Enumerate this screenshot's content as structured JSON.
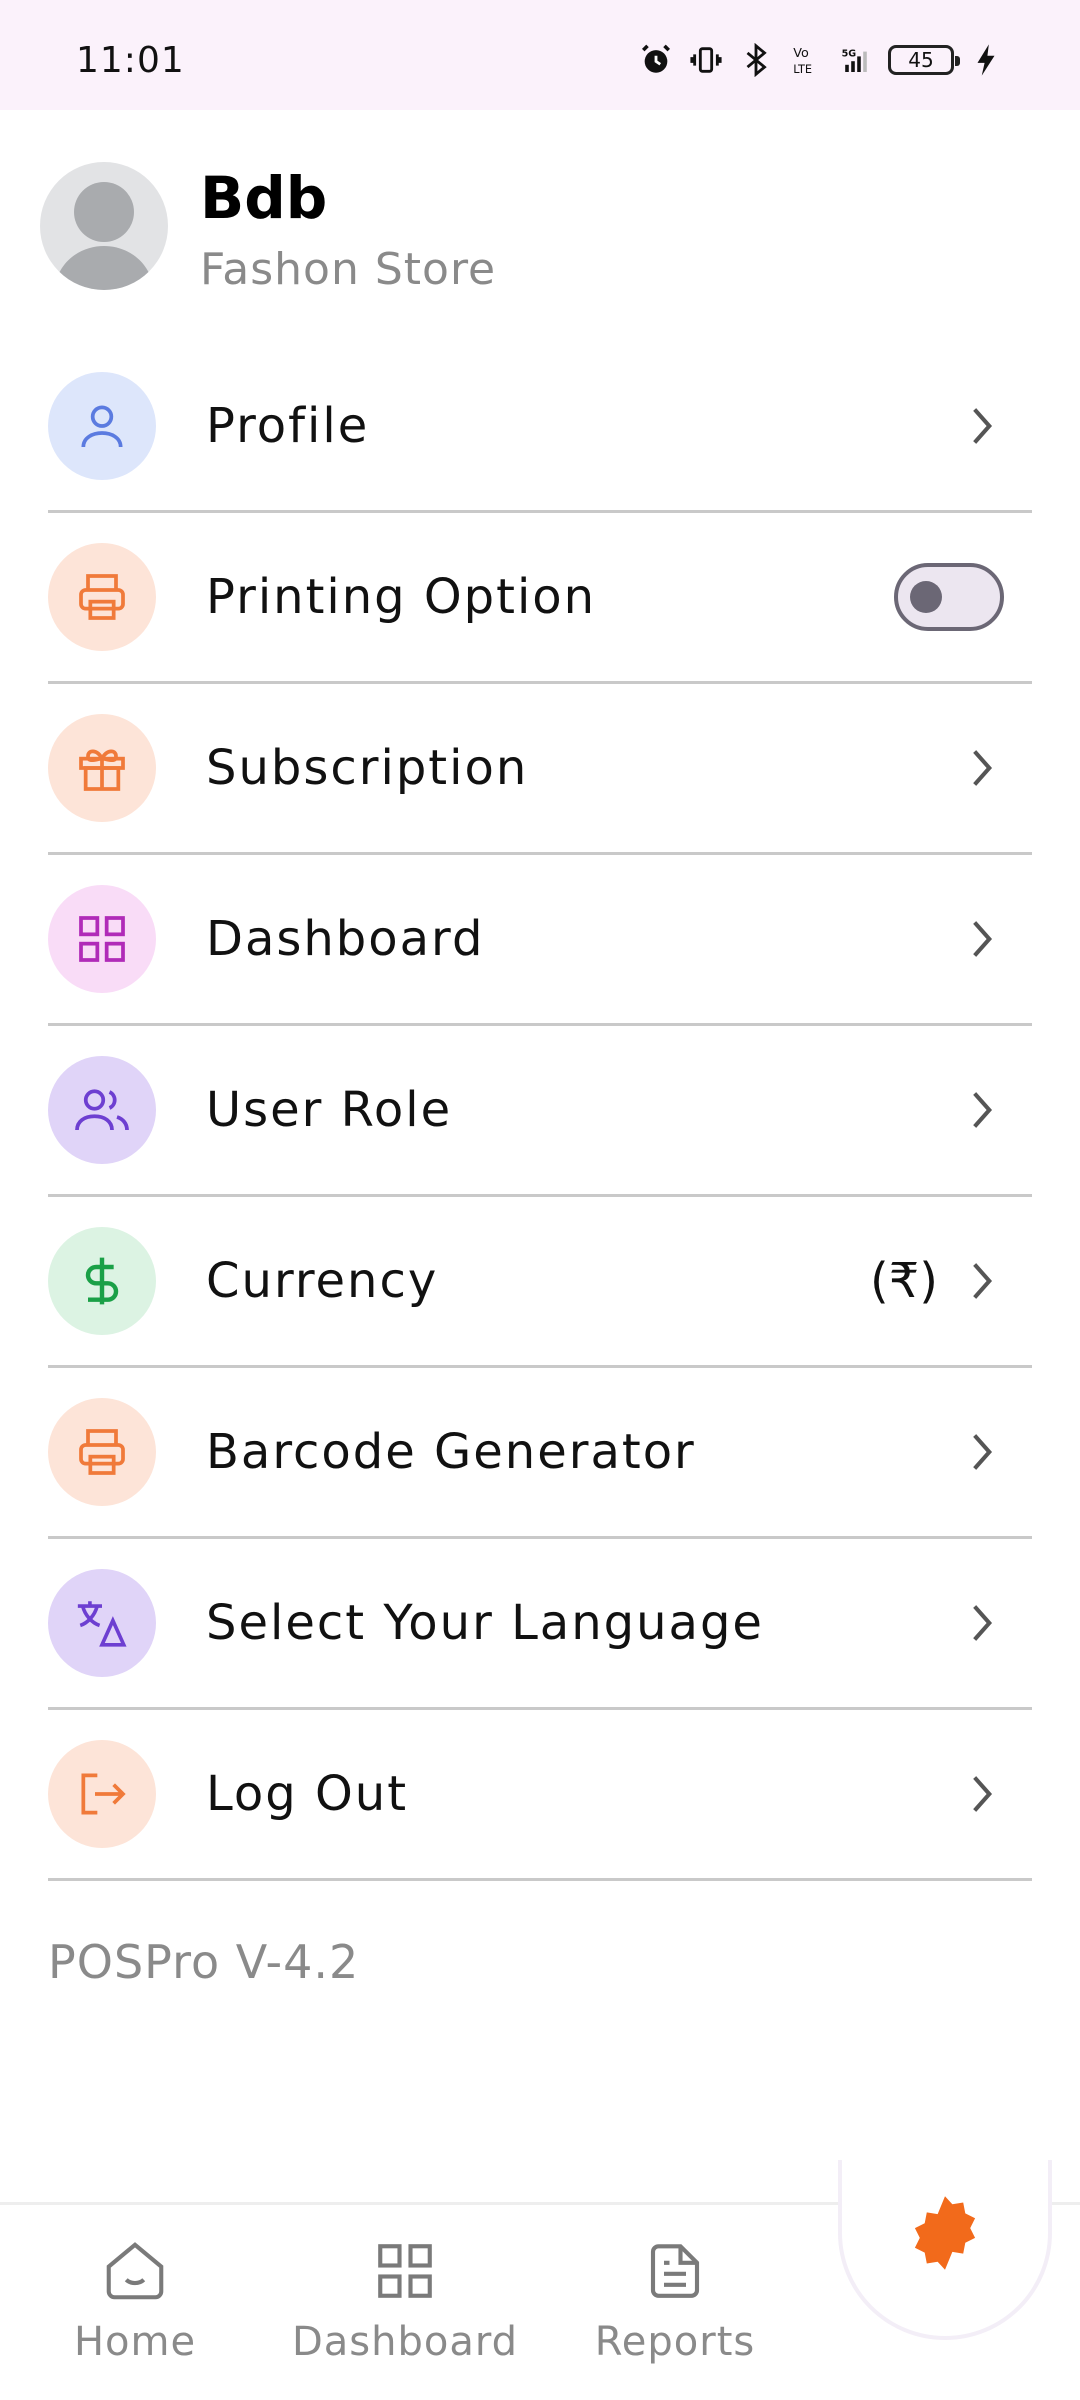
{
  "status_bar": {
    "time": "11:01",
    "battery": "45",
    "icons": [
      "alarm-icon",
      "vibrate-icon",
      "bluetooth-icon",
      "volte-icon",
      "5g-signal-icon",
      "battery-icon",
      "charging-icon"
    ]
  },
  "header": {
    "user_name": "Bdb",
    "store_name": "Fashon Store"
  },
  "menu": {
    "items": [
      {
        "label": "Profile",
        "icon": "user-icon",
        "color": "#5b7be0",
        "bg": "#dde6fb"
      },
      {
        "label": "Printing Option",
        "icon": "printer-icon",
        "color": "#f07a3a",
        "bg": "#fde4d8"
      },
      {
        "label": "Subscription",
        "icon": "gift-icon",
        "color": "#f07a3a",
        "bg": "#fde4d8"
      },
      {
        "label": "Dashboard",
        "icon": "grid-icon",
        "color": "#b02bb8",
        "bg": "#f9dcf7"
      },
      {
        "label": "User Role",
        "icon": "users-icon",
        "color": "#6d3fd1",
        "bg": "#e0d4f8"
      },
      {
        "label": "Currency",
        "icon": "dollar-icon",
        "color": "#1aa047",
        "bg": "#dcf3e3",
        "value": "(₹)"
      },
      {
        "label": "Barcode Generator",
        "icon": "printer-icon",
        "color": "#f07a3a",
        "bg": "#fde4d8"
      },
      {
        "label": "Select Your Language",
        "icon": "translate-icon",
        "color": "#6d3fd1",
        "bg": "#e0d4f8"
      },
      {
        "label": "Log Out",
        "icon": "logout-icon",
        "color": "#f07a3a",
        "bg": "#fde4d8"
      }
    ],
    "printing_toggle_on": false
  },
  "version": "POSPro V-4.2",
  "bottom_nav": {
    "items": [
      {
        "label": "Home",
        "icon": "home-icon"
      },
      {
        "label": "Dashboard",
        "icon": "grid-icon"
      },
      {
        "label": "Reports",
        "icon": "document-icon"
      }
    ],
    "fab_icon": "gear-icon",
    "accent": "#f26a1b"
  }
}
